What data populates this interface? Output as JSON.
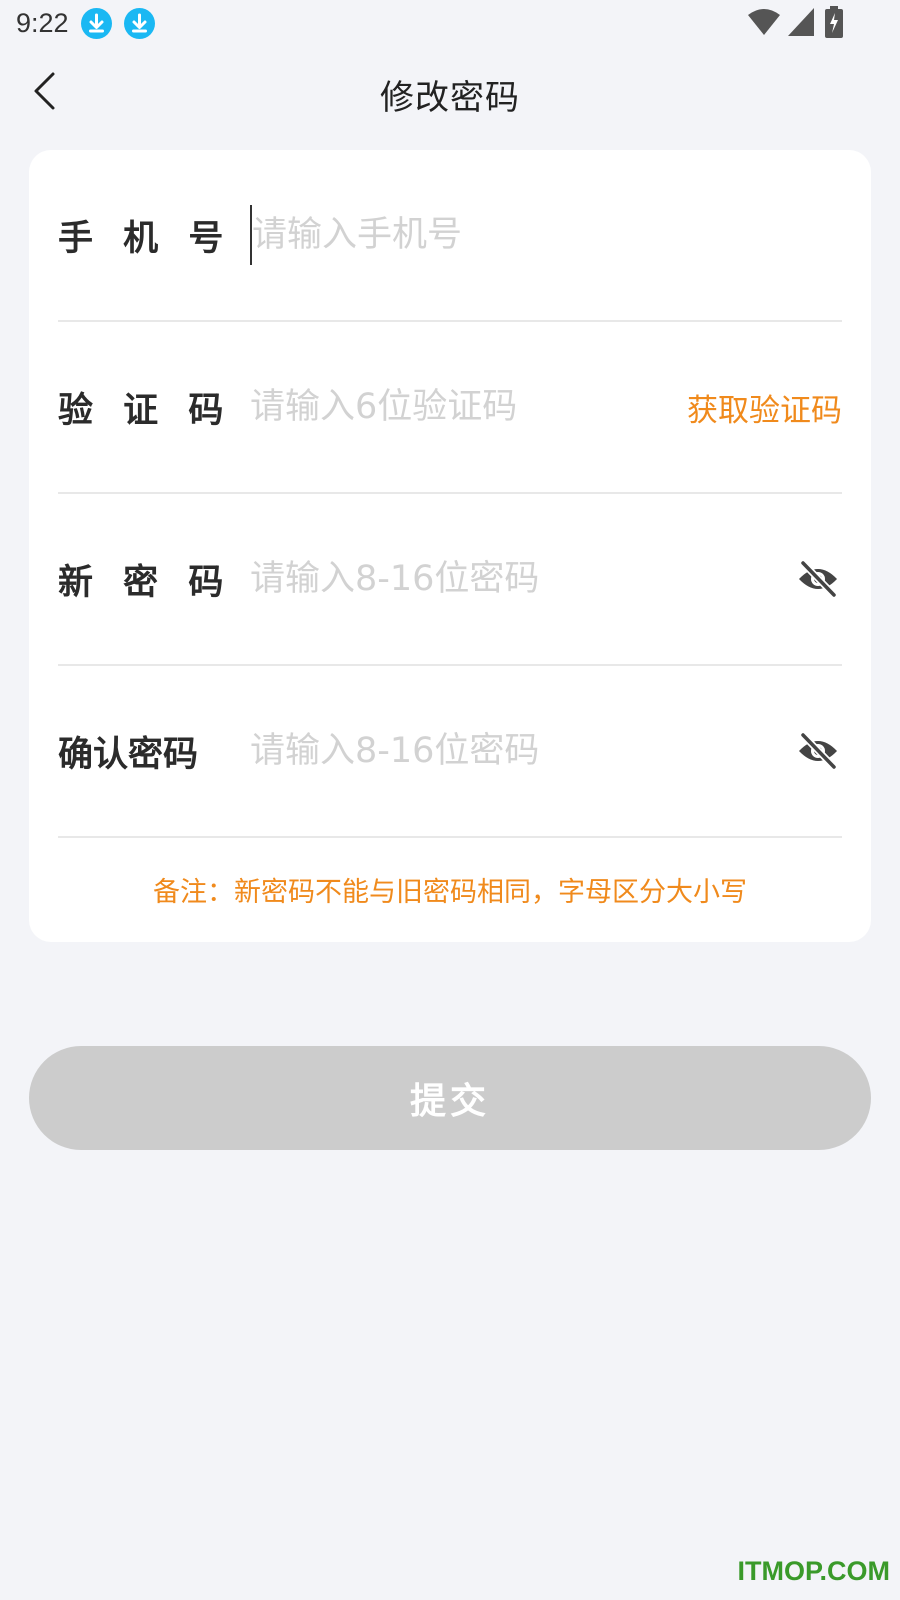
{
  "status_bar": {
    "time": "9:22",
    "icons": [
      "download-icon",
      "download-icon",
      "wifi-icon",
      "signal-icon",
      "battery-charging-icon"
    ],
    "download_icon_color": "#1ab8f3"
  },
  "nav": {
    "back_icon": "chevron-left-icon",
    "title": "修改密码"
  },
  "form": {
    "phone": {
      "label": "手 机 号",
      "placeholder": "请输入手机号",
      "value": ""
    },
    "code": {
      "label": "验 证 码",
      "placeholder": "请输入6位验证码",
      "value": "",
      "get_code_label": "获取验证码"
    },
    "new_password": {
      "label": "新 密 码",
      "placeholder": "请输入8-16位密码",
      "value": "",
      "toggle_icon": "eye-off-icon"
    },
    "confirm_password": {
      "label": "确认密码",
      "placeholder": "请输入8-16位密码",
      "value": "",
      "toggle_icon": "eye-off-icon"
    },
    "note": "备注：新密码不能与旧密码相同，字母区分大小写"
  },
  "submit": {
    "label": "提交",
    "disabled": true
  },
  "colors": {
    "accent": "#f08a1c",
    "background": "#f3f4f8",
    "card": "#ffffff",
    "button_disabled": "#cccccc",
    "placeholder": "#d2d2d2"
  },
  "watermark": {
    "text": "ITMOP.COM"
  }
}
